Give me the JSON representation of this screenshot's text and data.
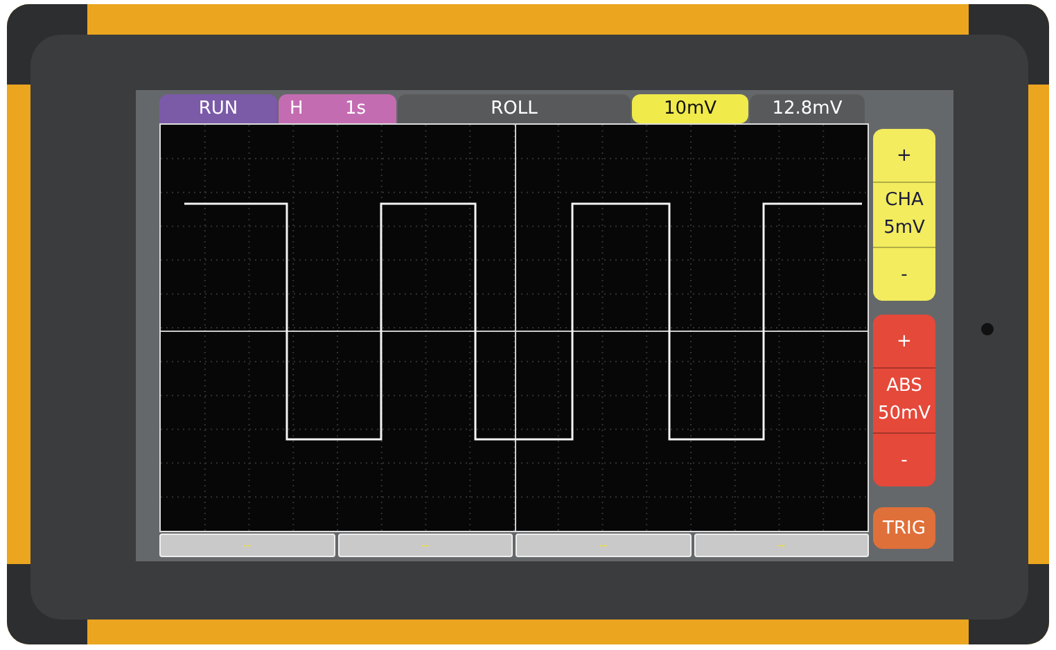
{
  "top_bar": [
    {
      "kind": "single",
      "text": "RUN",
      "color": "#7b5aa8"
    },
    {
      "kind": "pair",
      "text": "H",
      "value": "1s",
      "color": "#c46cb2"
    },
    {
      "kind": "single",
      "text": "ROLL",
      "color": "#58595a"
    },
    {
      "kind": "single",
      "text": "10mV",
      "color": "#f0ea4a"
    },
    {
      "kind": "single",
      "text": "12.8mV",
      "color": "#58595a"
    }
  ],
  "side_controls": [
    {
      "kind": "stepper",
      "increment": "+",
      "label": "CHA",
      "value": "5mV",
      "decrement": "-",
      "color": "#f2ec5e"
    },
    {
      "kind": "stepper",
      "increment": "+",
      "label": "ABS",
      "value": "50mV",
      "decrement": "-",
      "color": "#e5493a"
    },
    {
      "kind": "button",
      "label": "TRIG",
      "color": "#e0703a"
    }
  ],
  "soft_keys": [
    "--",
    "--",
    "--",
    "--"
  ]
}
